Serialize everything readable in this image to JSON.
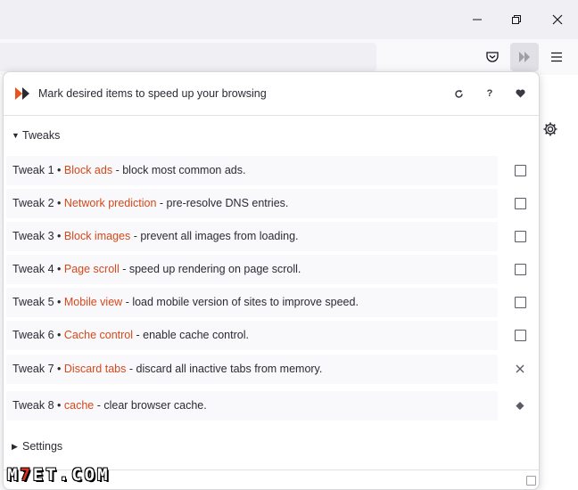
{
  "window": {
    "minimize_icon": "minimize-icon",
    "restore_icon": "restore-icon",
    "close_icon": "close-icon"
  },
  "toolbar": {
    "pocket_icon": "pocket-icon",
    "extension_icon": "double-arrow-icon",
    "menu_icon": "hamburger-menu-icon"
  },
  "popup": {
    "header": {
      "title": "Mark desired items to speed up your browsing",
      "icons": [
        "reload-icon",
        "help-icon",
        "heart-icon"
      ],
      "help_glyph": "?"
    },
    "tweaks_section": {
      "label": "Tweaks",
      "expanded": true
    },
    "tweaks": [
      {
        "prefix": "Tweak 1 •",
        "name": "Block ads",
        "desc": "- block most common ads.",
        "control": "checkbox",
        "checked": false
      },
      {
        "prefix": "Tweak 2 •",
        "name": "Network prediction",
        "desc": "- pre-resolve DNS entries.",
        "control": "checkbox",
        "checked": false
      },
      {
        "prefix": "Tweak 3 •",
        "name": "Block images",
        "desc": "- prevent all images from loading.",
        "control": "checkbox",
        "checked": false
      },
      {
        "prefix": "Tweak 4 •",
        "name": "Page scroll",
        "desc": "- speed up rendering on page scroll.",
        "control": "checkbox",
        "checked": false
      },
      {
        "prefix": "Tweak 5 •",
        "name": "Mobile view",
        "desc": "- load mobile version of sites to improve speed.",
        "control": "checkbox",
        "checked": false
      },
      {
        "prefix": "Tweak 6 •",
        "name": "Cache control",
        "desc": "- enable cache control.",
        "control": "checkbox",
        "checked": false
      },
      {
        "prefix": "Tweak 7 •",
        "name": "Discard tabs",
        "desc": "- discard all inactive tabs from memory.",
        "control": "close-icon"
      },
      {
        "prefix": "Tweak 8 •",
        "name": "cache",
        "desc": "- clear browser cache.",
        "control": "eraser-icon"
      }
    ],
    "settings_section": {
      "label": "Settings",
      "expanded": false
    }
  },
  "watermark": {
    "part1": "M",
    "part2": "7",
    "part3": "ET.COM"
  },
  "colors": {
    "accent": "#d6471a",
    "brand_logo": "#e8541c"
  }
}
